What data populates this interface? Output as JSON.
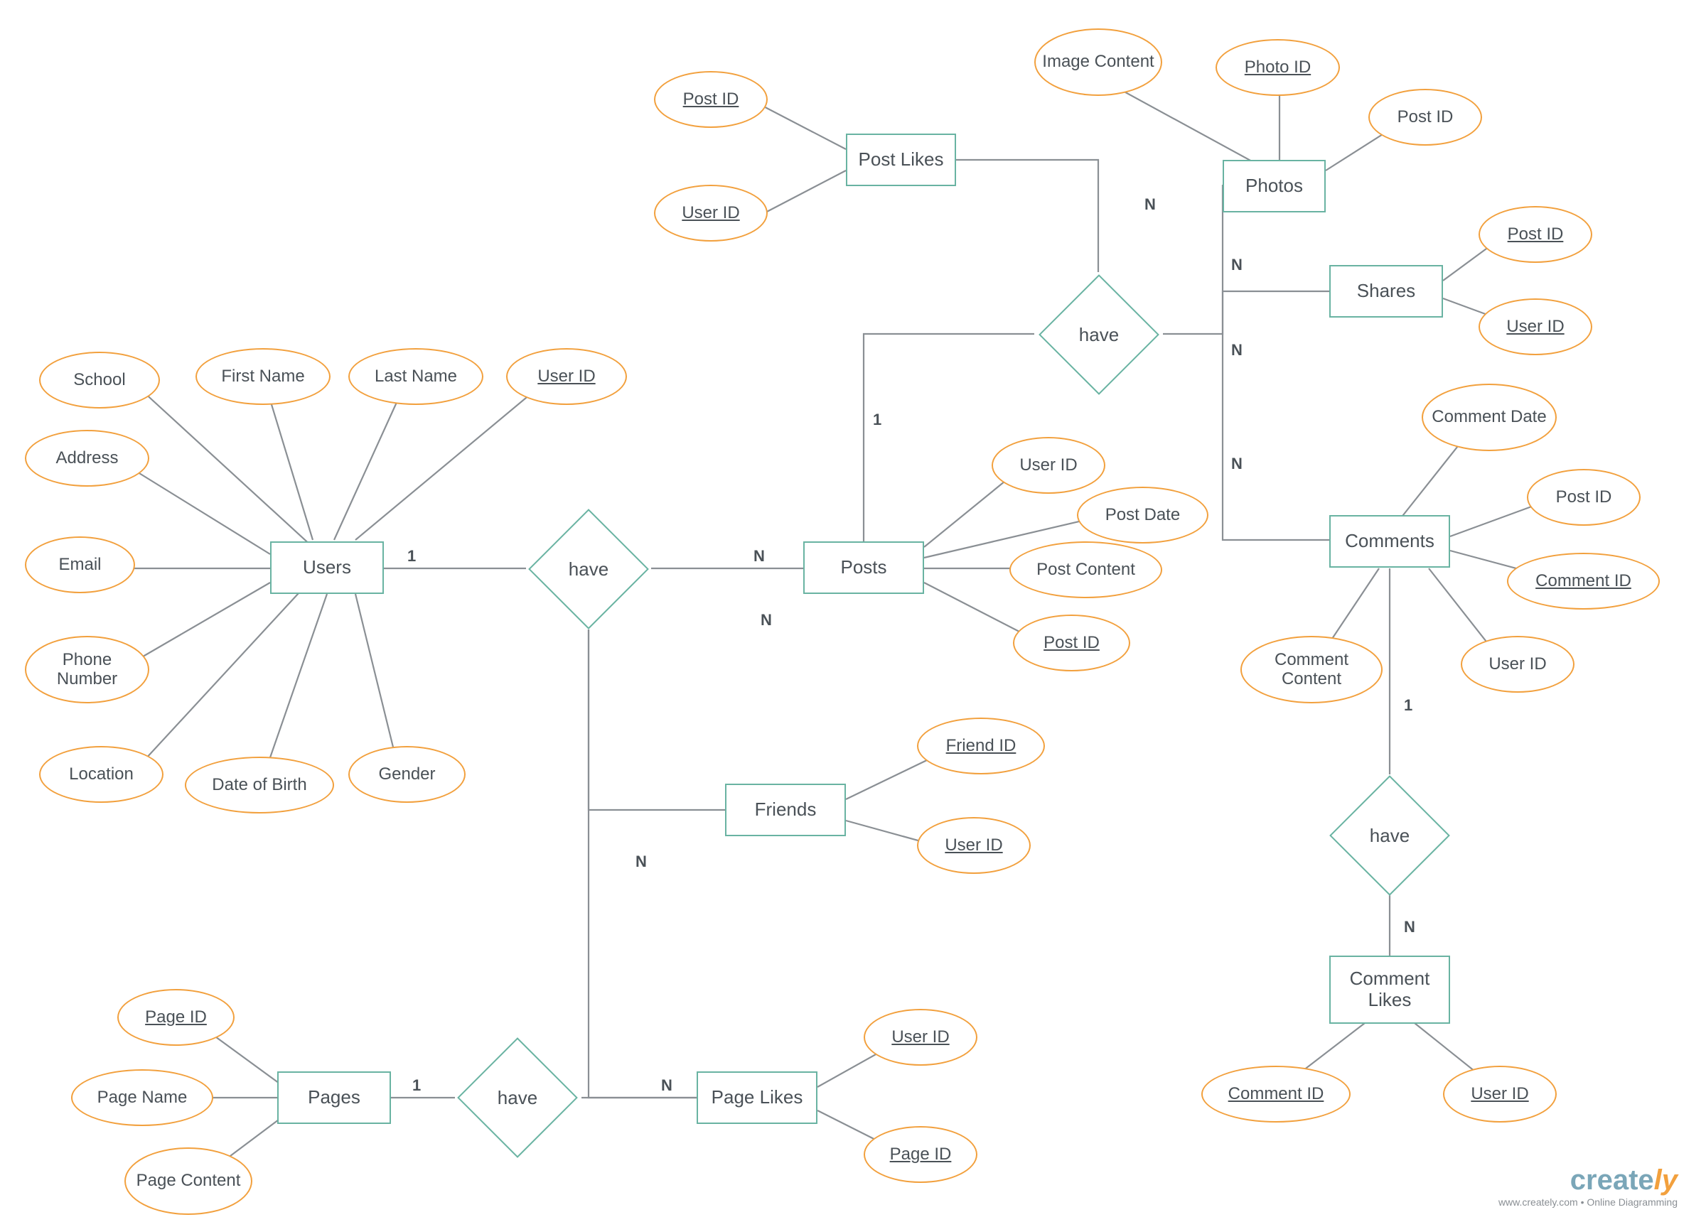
{
  "diagram_type": "Entity-Relationship Diagram",
  "entities": {
    "users": {
      "label": "Users",
      "attributes": {
        "school": "School",
        "first_name": "First Name",
        "last_name": "Last Name",
        "user_id": "User ID",
        "address": "Address",
        "email": "Email",
        "phone_number": "Phone Number",
        "location": "Location",
        "date_of_birth": "Date of Birth",
        "gender": "Gender"
      }
    },
    "posts": {
      "label": "Posts",
      "attributes": {
        "user_id": "User ID",
        "post_date": "Post Date",
        "post_content": "Post Content",
        "post_id": "Post ID"
      }
    },
    "post_likes": {
      "label": "Post Likes",
      "attributes": {
        "post_id": "Post ID",
        "user_id": "User ID"
      }
    },
    "photos": {
      "label": "Photos",
      "attributes": {
        "image_content": "Image Content",
        "photo_id": "Photo ID",
        "post_id": "Post ID"
      }
    },
    "shares": {
      "label": "Shares",
      "attributes": {
        "post_id": "Post ID",
        "user_id": "User ID"
      }
    },
    "comments": {
      "label": "Comments",
      "attributes": {
        "comment_date": "Comment Date",
        "post_id": "Post ID",
        "comment_id": "Comment ID",
        "user_id": "User ID",
        "comment_content": "Comment Content"
      }
    },
    "friends": {
      "label": "Friends",
      "attributes": {
        "friend_id": "Friend ID",
        "user_id": "User ID"
      }
    },
    "page_likes": {
      "label": "Page Likes",
      "attributes": {
        "user_id": "User ID",
        "page_id": "Page ID"
      }
    },
    "pages": {
      "label": "Pages",
      "attributes": {
        "page_id": "Page ID",
        "page_name": "Page Name",
        "page_content": "Page Content"
      }
    },
    "comment_likes": {
      "label": "Comment Likes",
      "attributes": {
        "comment_id": "Comment ID",
        "user_id": "User ID"
      }
    }
  },
  "relationships": {
    "users_posts_have": {
      "label": "have",
      "left": "Users",
      "right": "Posts",
      "left_card": "1",
      "right_card": "N"
    },
    "posts_have_fan": {
      "label": "have",
      "from": "Posts",
      "from_card": "1",
      "to": [
        "Photos",
        "Shares",
        "Comments",
        "Post Likes"
      ],
      "to_card": "N"
    },
    "pages_pagelikes_have": {
      "label": "have",
      "left": "Pages",
      "right": "Page Likes",
      "left_card": "1",
      "right_card": "N"
    },
    "comments_commentlikes_have": {
      "label": "have",
      "from": "Comments",
      "from_card": "1",
      "to": "Comment Likes",
      "to_card": "N"
    },
    "friends_from_have": {
      "card": "N",
      "via": "users_posts_have"
    },
    "pagelikes_from_have": {
      "card": "N",
      "via": "users_posts_have"
    }
  },
  "footer": {
    "brand_a": "create",
    "brand_b": "ly",
    "tagline": "www.creately.com • Online Diagramming"
  }
}
